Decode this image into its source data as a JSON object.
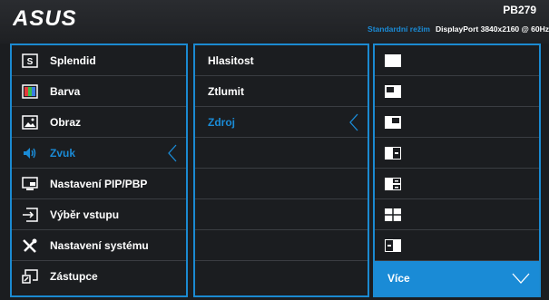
{
  "brand": "ASUS",
  "model": "PB279",
  "status": {
    "mode": "Standardní režim",
    "signal": "DisplayPort  3840x2160 @ 60Hz"
  },
  "main_menu": [
    {
      "label": "Splendid",
      "icon": "splendid-icon"
    },
    {
      "label": "Barva",
      "icon": "color-icon"
    },
    {
      "label": "Obraz",
      "icon": "image-icon"
    },
    {
      "label": "Zvuk",
      "icon": "speaker-icon",
      "selected": true
    },
    {
      "label": "Nastavení PIP/PBP",
      "icon": "pip-pbp-icon"
    },
    {
      "label": "Výběr vstupu",
      "icon": "input-select-icon"
    },
    {
      "label": "Nastavení systému",
      "icon": "tools-icon"
    },
    {
      "label": "Zástupce",
      "icon": "shortcut-icon"
    }
  ],
  "sub_menu": [
    {
      "label": "Hlasitost"
    },
    {
      "label": "Ztlumit"
    },
    {
      "label": "Zdroj",
      "selected": true
    }
  ],
  "source_options": [
    {
      "icon": "layout-full-icon"
    },
    {
      "icon": "layout-pip-bottom-left-icon"
    },
    {
      "icon": "layout-pip-top-right-icon"
    },
    {
      "icon": "layout-pbp-left-icon"
    },
    {
      "icon": "layout-triple-icon"
    },
    {
      "icon": "layout-quad-icon"
    },
    {
      "icon": "layout-pbp-right-icon"
    }
  ],
  "more_label": "Více",
  "colors": {
    "accent": "#1a8bd6",
    "background": "#1b1d20",
    "text": "#ffffff"
  }
}
